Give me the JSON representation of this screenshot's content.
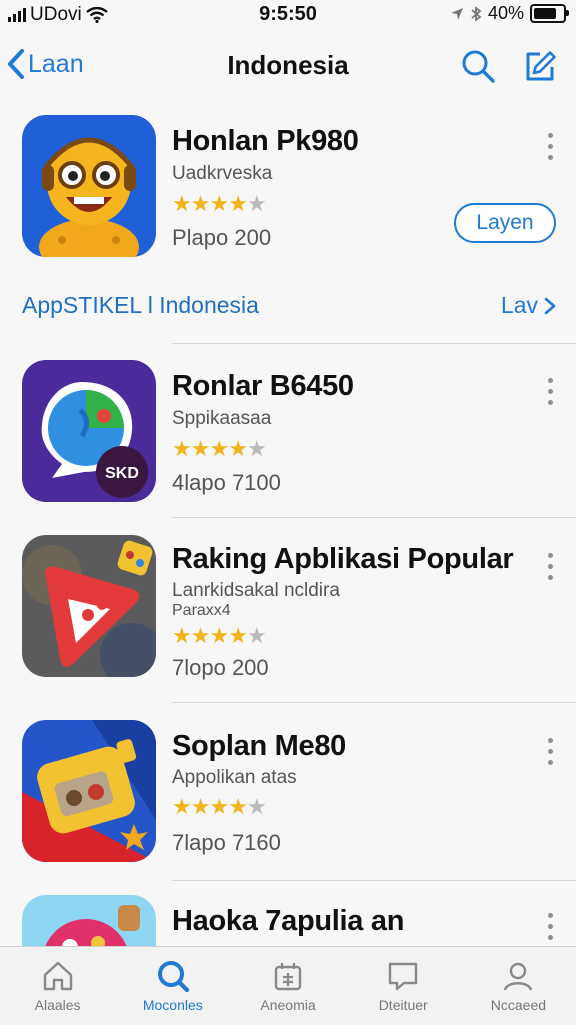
{
  "status_bar": {
    "carrier": "UDovi",
    "time": "9:5:50",
    "battery_text": "40%",
    "battery_level": 0.9
  },
  "nav": {
    "back_label": "Laan",
    "title": "Indonesia"
  },
  "section": {
    "title": "AppSTIKEL l Indonesia",
    "link": "Lav"
  },
  "apps": [
    {
      "name": "Honlan Pk980",
      "subtitle": "Uadkrveska",
      "rating": 4,
      "size": "Plapo 200",
      "action": "Layen"
    },
    {
      "name": "Ronlar B6450",
      "subtitle": "Sppikaasaa",
      "rating": 4,
      "size": "4lapo 7100",
      "badge": "SKD"
    },
    {
      "name": "Raking Apblikasi Popular",
      "subtitle": "Lanrkidsakal ncldira",
      "subtitle2": "Paraxx4",
      "rating": 4,
      "size": "7lopo 200"
    },
    {
      "name": "Soplan Me80",
      "subtitle": "Appolikan atas",
      "rating": 4,
      "size": "7lapo 7160"
    },
    {
      "name": "Haoka 7apulia an"
    }
  ],
  "tabs": [
    {
      "label": "Alaales",
      "icon": "home-icon",
      "active": false
    },
    {
      "label": "Moconles",
      "icon": "search-icon",
      "active": true
    },
    {
      "label": "Aneomia",
      "icon": "apps-icon",
      "active": false
    },
    {
      "label": "Dteituer",
      "icon": "chat-icon",
      "active": false
    },
    {
      "label": "Nccaeed",
      "icon": "person-icon",
      "active": false
    }
  ],
  "colors": {
    "accent": "#1f7ad6",
    "star": "#f0b51c",
    "star_off": "#b9b9b9"
  }
}
